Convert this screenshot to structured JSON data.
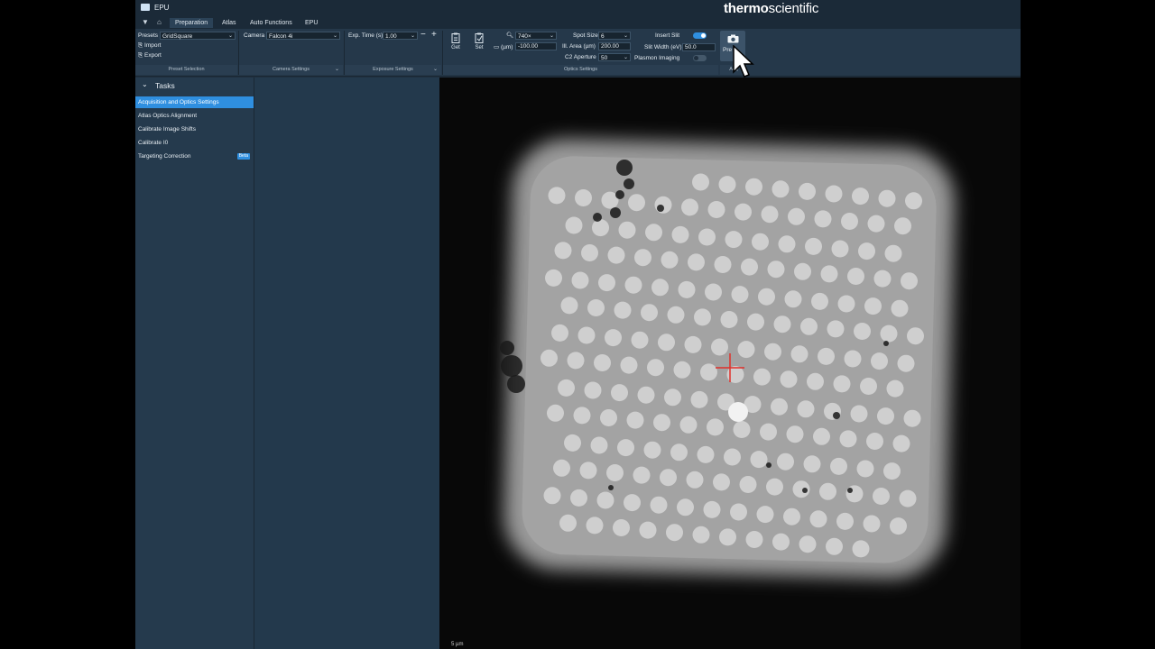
{
  "app": {
    "title": "EPU",
    "brand_bold": "thermo",
    "brand_light": "scientific"
  },
  "tabs": [
    "Preparation",
    "Atlas",
    "Auto Functions",
    "EPU"
  ],
  "ribbon": {
    "presets_label": "Presets",
    "presets_value": "GridSquare",
    "import_label": "Import",
    "export_label": "Export",
    "camera_label": "Camera",
    "camera_value": "Falcon 4i",
    "exp_time_label": "Exp. Time (s)",
    "exp_time_value": "1.00",
    "get_label": "Get",
    "set_label": "Set",
    "mag_value": "740×",
    "defocus_label": "(µm)",
    "defocus_value": "-100.00",
    "spot_size_label": "Spot Size",
    "spot_size_value": "6",
    "ill_area_label": "Ill. Area (µm)",
    "ill_area_value": "200.00",
    "c2_aperture_label": "C2 Aperture",
    "c2_aperture_value": "50",
    "insert_slit_label": "Insert Slit",
    "slit_width_label": "Slit Width (eV)",
    "slit_width_value": "50.0",
    "plasmon_label": "Plasmon Imaging",
    "preview_label": "Pre",
    "acq_section_label": "Acq",
    "sections": [
      "Preset Selection",
      "Camera Settings",
      "Exposure Settings",
      "Optics Settings"
    ]
  },
  "toggles": {
    "insert_slit": true,
    "plasmon_imaging": false
  },
  "tasks": {
    "header": "Tasks",
    "items": [
      {
        "label": "Acquisition and Optics Settings",
        "selected": true
      },
      {
        "label": "Atlas Optics Alignment"
      },
      {
        "label": "Calibrate Image Shifts"
      },
      {
        "label": "Calibrate I0"
      },
      {
        "label": "Targeting Correction",
        "badge": "Beta"
      }
    ]
  },
  "viewer": {
    "scalebar": "5 µm"
  },
  "colors": {
    "accent": "#2f8fe0",
    "crosshair": "#e0302a"
  }
}
